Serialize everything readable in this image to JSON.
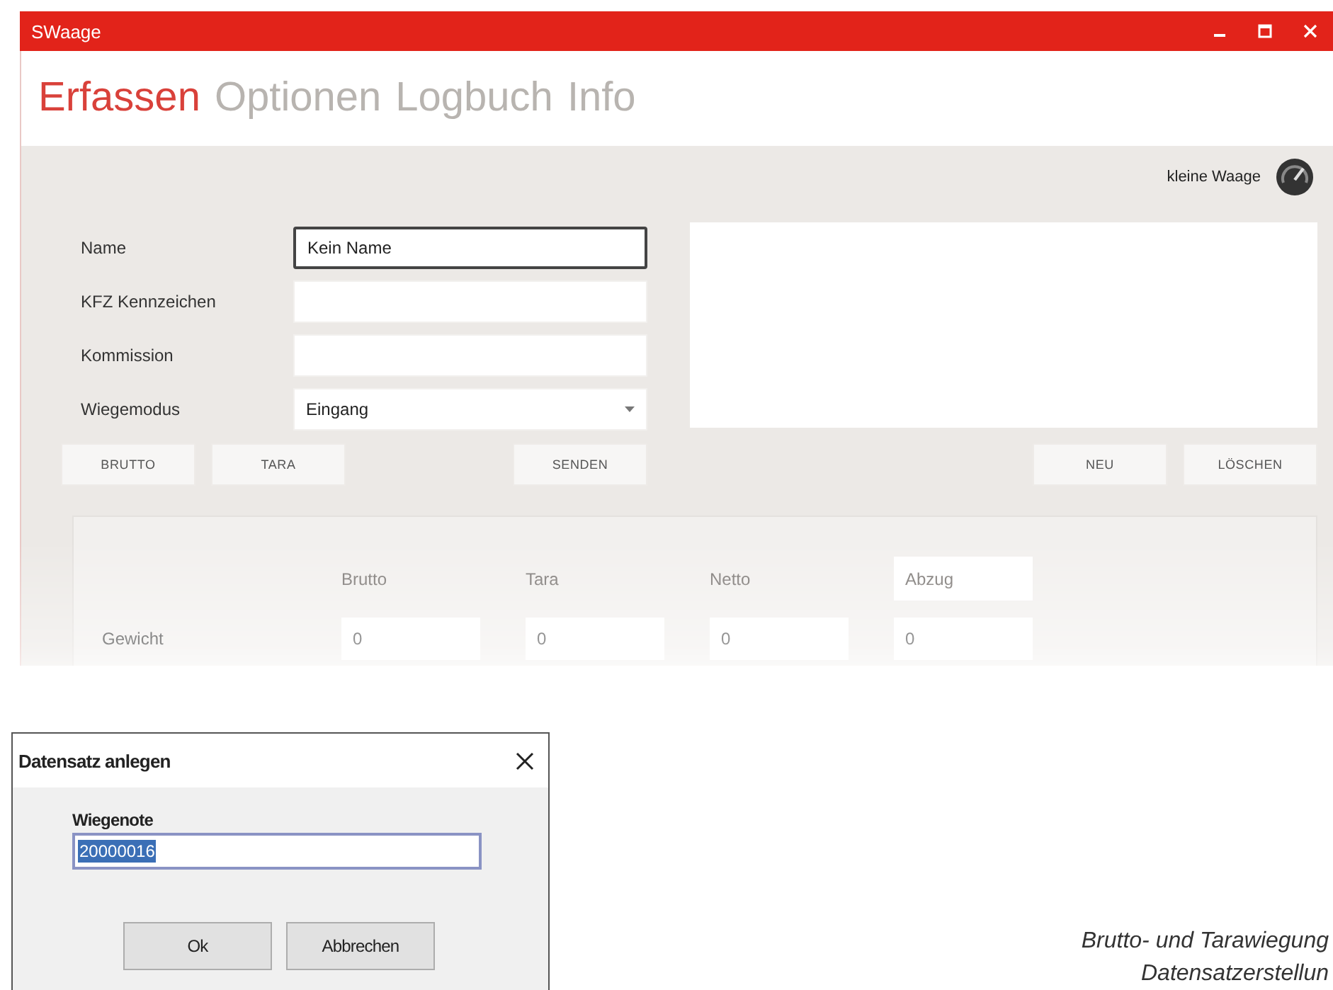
{
  "window": {
    "title": "SWaage"
  },
  "tabs": [
    {
      "label": "Erfassen",
      "selected": true
    },
    {
      "label": "Optionen",
      "selected": false
    },
    {
      "label": "Logbuch",
      "selected": false
    },
    {
      "label": "Info",
      "selected": false
    }
  ],
  "scale": {
    "label": "kleine Waage"
  },
  "form": {
    "fields": [
      {
        "label": "Name",
        "kind": "text",
        "value": "Kein Name",
        "focused": true
      },
      {
        "label": "KFZ Kennzeichen",
        "kind": "text",
        "focused": false
      },
      {
        "label": "Kommission",
        "kind": "text",
        "focused": false
      },
      {
        "label": "Wiegemodus",
        "kind": "dropdown",
        "value": "Eingang",
        "focused": false
      }
    ]
  },
  "form_buttons": [
    "BRUTTO",
    "TARA",
    "SENDEN"
  ],
  "list_buttons": [
    "NEU",
    "LÖSCHEN"
  ],
  "weights": {
    "columns": [
      {
        "label": "Brutto",
        "kind": "text"
      },
      {
        "label": "Tara",
        "kind": "text"
      },
      {
        "label": "Netto",
        "kind": "text"
      },
      {
        "label": "Abzug",
        "kind": "field"
      }
    ],
    "rows": [
      {
        "label": "Gewicht",
        "values": [
          "0",
          "0",
          "0",
          "0"
        ]
      }
    ]
  },
  "dialog": {
    "title": "Datensatz anlegen",
    "field_label": "Wiegenote",
    "value": "20000016",
    "value_selected": true,
    "buttons": [
      "Ok",
      "Abbrechen"
    ]
  },
  "caption": [
    "Brutto- und Tarawiegung",
    "Datensatzerstellun"
  ]
}
